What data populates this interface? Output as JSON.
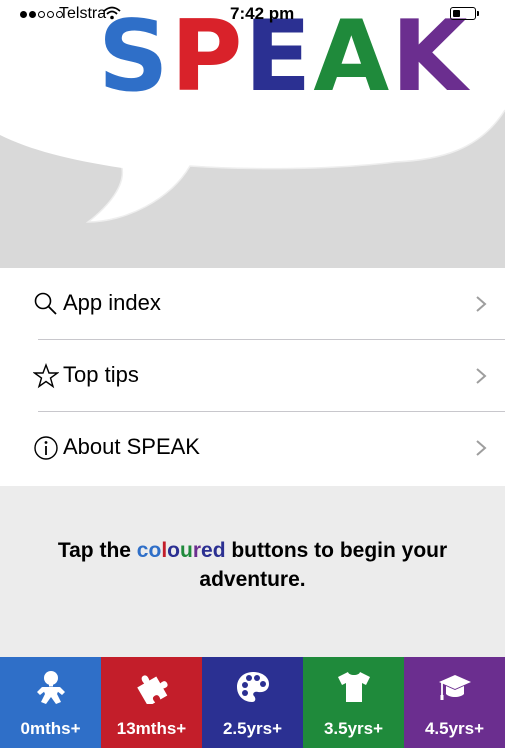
{
  "status_bar": {
    "carrier": "Telstra",
    "time": "7:42 pm",
    "signal_bars_filled": 2,
    "signal_bars_total": 5,
    "battery_level": 0.3
  },
  "logo": {
    "letters": [
      {
        "char": "S",
        "color": "#2f6fc8"
      },
      {
        "char": "P",
        "color": "#d9222a"
      },
      {
        "char": "E",
        "color": "#2b3092"
      },
      {
        "char": "A",
        "color": "#1f8a3b"
      },
      {
        "char": "K",
        "color": "#6b2e8f"
      }
    ]
  },
  "menu": {
    "items": [
      {
        "label": "App index",
        "icon": "search-icon"
      },
      {
        "label": "Top tips",
        "icon": "star-icon"
      },
      {
        "label": "About SPEAK",
        "icon": "info-icon"
      }
    ]
  },
  "instruction": {
    "part1": "Tap the ",
    "colored_word": [
      "c",
      "o",
      "l",
      "o",
      "u",
      "r",
      "e",
      "d"
    ],
    "part2": " buttons to begin your adventure."
  },
  "age_tabs": [
    {
      "label": "0mths+",
      "icon": "baby-icon",
      "color": "#2f6fc8"
    },
    {
      "label": "13mths+",
      "icon": "puzzle-icon",
      "color": "#c31e2a"
    },
    {
      "label": "2.5yrs+",
      "icon": "palette-icon",
      "color": "#2b3092"
    },
    {
      "label": "3.5yrs+",
      "icon": "tshirt-icon",
      "color": "#1f8a3b"
    },
    {
      "label": "4.5yrs+",
      "icon": "graduation-cap-icon",
      "color": "#6b2e8f"
    }
  ]
}
